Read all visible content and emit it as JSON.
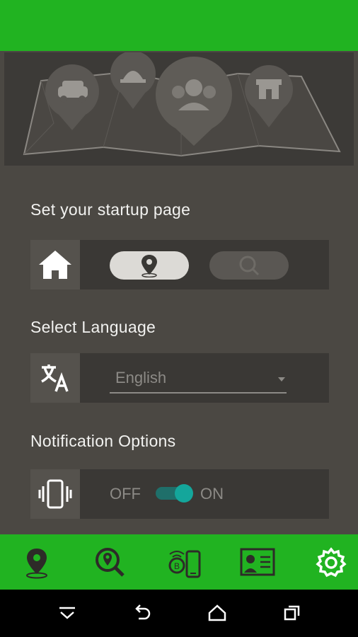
{
  "startup": {
    "title": "Set your startup page",
    "icon": "home-icon",
    "options": [
      "map-pin-icon",
      "search-pin-icon"
    ],
    "selected_index": 0
  },
  "language": {
    "title": "Select Language",
    "icon": "translate-icon",
    "value": "English"
  },
  "notifications": {
    "title": "Notification Options",
    "icon": "vibrate-icon",
    "off_label": "OFF",
    "on_label": "ON",
    "state": "on"
  },
  "bottom_nav": [
    {
      "icon": "map-pin-icon"
    },
    {
      "icon": "search-pin-icon"
    },
    {
      "icon": "beacon-phone-icon"
    },
    {
      "icon": "id-card-icon"
    },
    {
      "icon": "gear-icon",
      "active": true
    }
  ],
  "colors": {
    "brand": "#21b321",
    "accent": "#14a69b",
    "background": "#4b4843"
  }
}
